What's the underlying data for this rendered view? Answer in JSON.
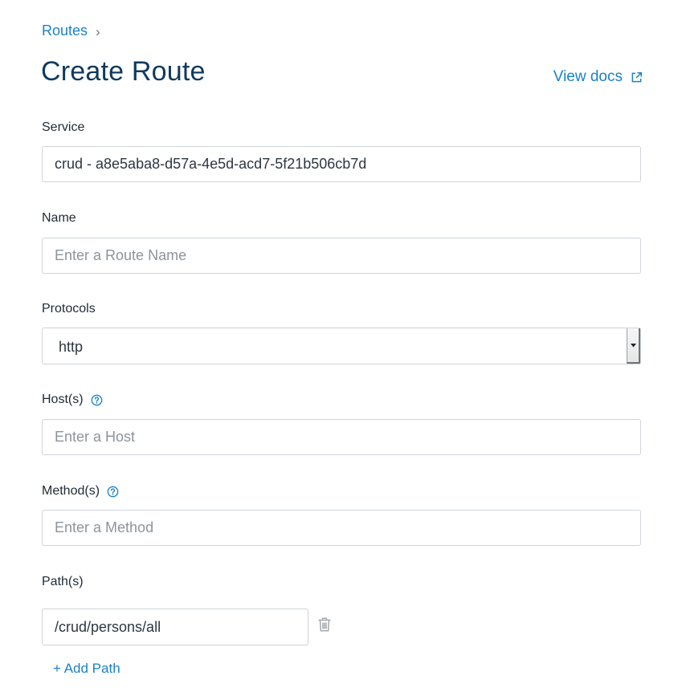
{
  "breadcrumb": {
    "parent": "Routes",
    "separator": "›"
  },
  "page": {
    "title": "Create Route",
    "view_docs": "View docs"
  },
  "form": {
    "service": {
      "label": "Service",
      "value": "crud - a8e5aba8-d57a-4e5d-acd7-5f21b506cb7d"
    },
    "name": {
      "label": "Name",
      "placeholder": "Enter a Route Name",
      "value": ""
    },
    "protocols": {
      "label": "Protocols",
      "value": "http"
    },
    "hosts": {
      "label": "Host(s)",
      "placeholder": "Enter a Host",
      "value": ""
    },
    "methods": {
      "label": "Method(s)",
      "placeholder": "Enter a Method",
      "value": ""
    },
    "paths": {
      "label": "Path(s)",
      "items": [
        "/crud/persons/all"
      ],
      "add_label": "+ Add Path"
    }
  },
  "colors": {
    "link": "#1a82c8",
    "title": "#0f3a5f",
    "border": "#cfd4da"
  },
  "icons": {
    "external": "external-link-icon",
    "help": "help-circle-icon",
    "delete": "trash-icon",
    "dropdown": "caret-down-icon"
  }
}
